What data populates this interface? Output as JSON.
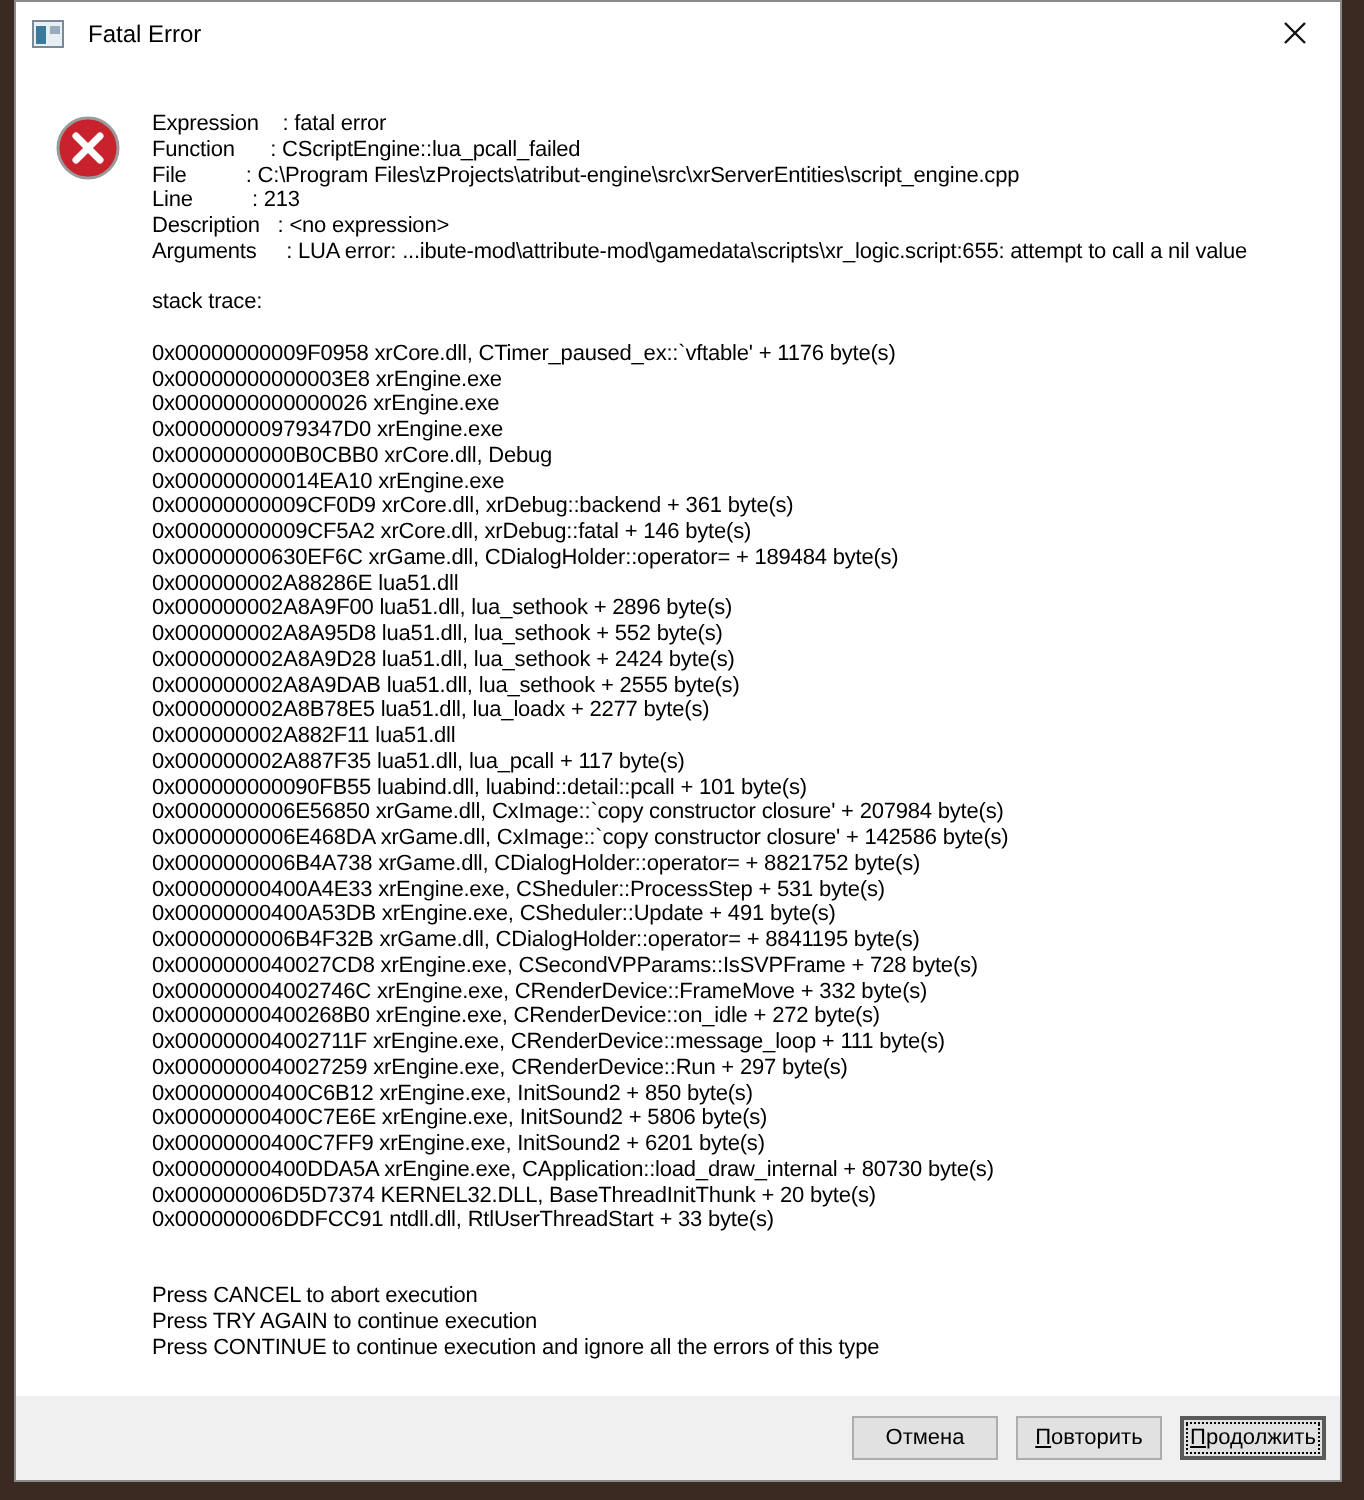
{
  "window": {
    "title": "Fatal Error"
  },
  "details": [
    "Expression    : fatal error",
    "Function      : CScriptEngine::lua_pcall_failed",
    "File          : C:\\Program Files\\zProjects\\atribut-engine\\src\\xrServerEntities\\script_engine.cpp",
    "Line          : 213",
    "Description   : <no expression>",
    "Arguments     : LUA error: ...ibute-mod\\attribute-mod\\gamedata\\scripts\\xr_logic.script:655: attempt to call a nil value"
  ],
  "stack_heading": "stack trace:",
  "stack_trace": [
    "0x00000000009F0958 xrCore.dll, CTimer_paused_ex::`vftable' + 1176 byte(s)",
    "0x00000000000003E8 xrEngine.exe",
    "0x0000000000000026 xrEngine.exe",
    "0x00000000979347D0 xrEngine.exe",
    "0x0000000000B0CBB0 xrCore.dll, Debug",
    "0x000000000014EA10 xrEngine.exe",
    "0x00000000009CF0D9 xrCore.dll, xrDebug::backend + 361 byte(s)",
    "0x00000000009CF5A2 xrCore.dll, xrDebug::fatal + 146 byte(s)",
    "0x00000000630EF6C xrGame.dll, CDialogHolder::operator= + 189484 byte(s)",
    "0x000000002A88286E lua51.dll",
    "0x000000002A8A9F00 lua51.dll, lua_sethook + 2896 byte(s)",
    "0x000000002A8A95D8 lua51.dll, lua_sethook + 552 byte(s)",
    "0x000000002A8A9D28 lua51.dll, lua_sethook + 2424 byte(s)",
    "0x000000002A8A9DAB lua51.dll, lua_sethook + 2555 byte(s)",
    "0x000000002A8B78E5 lua51.dll, lua_loadx + 2277 byte(s)",
    "0x000000002A882F11 lua51.dll",
    "0x000000002A887F35 lua51.dll, lua_pcall + 117 byte(s)",
    "0x000000000090FB55 luabind.dll, luabind::detail::pcall + 101 byte(s)",
    "0x0000000006E56850 xrGame.dll, CxImage::`copy constructor closure' + 207984 byte(s)",
    "0x0000000006E468DA xrGame.dll, CxImage::`copy constructor closure' + 142586 byte(s)",
    "0x0000000006B4A738 xrGame.dll, CDialogHolder::operator= + 8821752 byte(s)",
    "0x00000000400A4E33 xrEngine.exe, CSheduler::ProcessStep + 531 byte(s)",
    "0x00000000400A53DB xrEngine.exe, CSheduler::Update + 491 byte(s)",
    "0x0000000006B4F32B xrGame.dll, CDialogHolder::operator= + 8841195 byte(s)",
    "0x0000000040027CD8 xrEngine.exe, CSecondVPParams::IsSVPFrame + 728 byte(s)",
    "0x000000004002746C xrEngine.exe, CRenderDevice::FrameMove + 332 byte(s)",
    "0x00000000400268B0 xrEngine.exe, CRenderDevice::on_idle + 272 byte(s)",
    "0x000000004002711F xrEngine.exe, CRenderDevice::message_loop + 111 byte(s)",
    "0x0000000040027259 xrEngine.exe, CRenderDevice::Run + 297 byte(s)",
    "0x00000000400C6B12 xrEngine.exe, InitSound2 + 850 byte(s)",
    "0x00000000400C7E6E xrEngine.exe, InitSound2 + 5806 byte(s)",
    "0x00000000400C7FF9 xrEngine.exe, InitSound2 + 6201 byte(s)",
    "0x00000000400DDA5A xrEngine.exe, CApplication::load_draw_internal + 80730 byte(s)",
    "0x000000006D5D7374 KERNEL32.DLL, BaseThreadInitThunk + 20 byte(s)",
    "0x000000006DDFCC91 ntdll.dll, RtlUserThreadStart + 33 byte(s)"
  ],
  "instructions": [
    "Press CANCEL to abort execution",
    "Press TRY AGAIN to continue execution",
    "Press CONTINUE to continue execution and ignore all the errors of this type"
  ],
  "buttons": [
    {
      "label": "Отмена",
      "mnemonic": false,
      "focused": false
    },
    {
      "label": "Повторить",
      "mnemonic": true,
      "focused": false
    },
    {
      "label": "Продолжить",
      "mnemonic": true,
      "focused": true
    }
  ]
}
